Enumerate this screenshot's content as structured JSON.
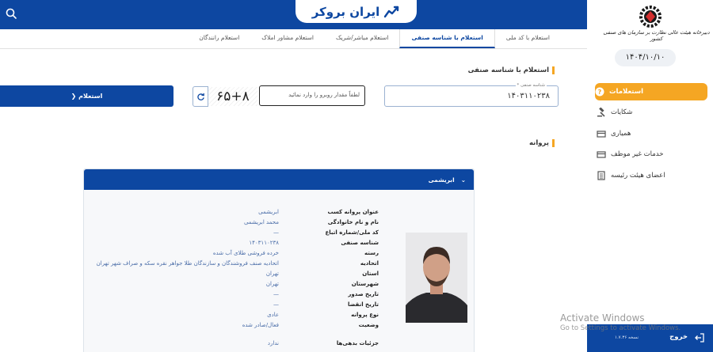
{
  "header": {
    "logo_text": "ایران بروکر"
  },
  "tabs": [
    {
      "label": "استعلام با کد ملی"
    },
    {
      "label": "استعلام با شناسه صنفی"
    },
    {
      "label": "استعلام مباشر/شریک"
    },
    {
      "label": "استعلام مشاور املاک"
    },
    {
      "label": "استعلام رانندگان"
    }
  ],
  "form": {
    "section_title": "استعلام با شناسه صنفی",
    "field_label": "شناسه صنفی *",
    "field_value": "۱۴۰۳۱۱۰۲۳۸",
    "captcha_placeholder": "لطفاً مقدار روبرو را وارد نمائید",
    "captcha_text": "۶۵+۸",
    "inquiry_button": "استعلام"
  },
  "license": {
    "section_title": "پروانه",
    "card_title": "ابریشمی",
    "fields": [
      {
        "label": "عنوان پروانه کسب",
        "value": "ابریشمی"
      },
      {
        "label": "نام و نام خانوادگی",
        "value": "محمد ابریشمی"
      },
      {
        "label": "کد ملی/شماره اتباع",
        "value": "—"
      },
      {
        "label": "شناسه صنفی",
        "value": "۱۴۰۳۱۱۰۲۳۸"
      },
      {
        "label": "رسته",
        "value": "خرده فروشی طلای آب شده"
      },
      {
        "label": "اتحادیه",
        "value": "اتحادیه صنف فروشندگان و سازندگان طلا جواهر نقره سکه و صراف شهر تهران"
      },
      {
        "label": "استان",
        "value": "تهران"
      },
      {
        "label": "شهرستان",
        "value": "تهران"
      },
      {
        "label": "تاریخ صدور",
        "value": "—"
      },
      {
        "label": "تاریخ انقضا",
        "value": "—"
      },
      {
        "label": "نوع پروانه",
        "value": "عادی"
      },
      {
        "label": "وضعیت",
        "value": "فعال/صادر شده"
      }
    ],
    "debt_label": "جزئیات بدهی‌ها",
    "debt_value": "ندارد"
  },
  "sidebar": {
    "org_name": "دبیرخانه هیئت عالی نظارت بر سازمان های صنفی کشور",
    "date": "۱۴۰۴/۱۰/۱۰",
    "menu": [
      {
        "label": "استعلامات",
        "icon": "question-icon",
        "active": true
      },
      {
        "label": "شکایات",
        "icon": "gavel-icon",
        "active": false
      },
      {
        "label": "همیاری",
        "icon": "card-icon",
        "active": false
      },
      {
        "label": "خدمات غیر موظف",
        "icon": "card-icon",
        "active": false
      },
      {
        "label": "اعضای هیئت رئیسه",
        "icon": "building-icon",
        "active": false
      }
    ],
    "logout_label": "خروج",
    "version": "نسخه ۱.۷.۳۶"
  },
  "watermark": {
    "title": "Activate Windows",
    "subtitle": "Go to Settings to activate Windows."
  },
  "colors": {
    "primary": "#0d47a1",
    "accent": "#f5a623"
  }
}
